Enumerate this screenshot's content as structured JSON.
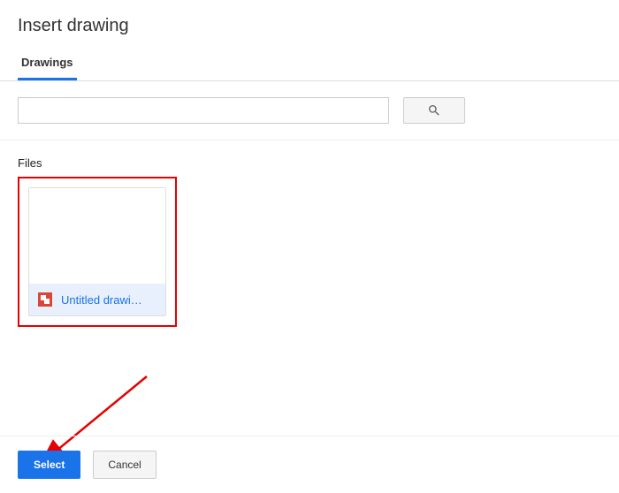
{
  "dialog": {
    "title": "Insert drawing"
  },
  "tabs": {
    "active": "Drawings"
  },
  "search": {
    "value": "",
    "placeholder": ""
  },
  "section": {
    "label": "Files"
  },
  "files": [
    {
      "name": "Untitled drawi…",
      "icon": "drawings-icon"
    }
  ],
  "footer": {
    "select_label": "Select",
    "cancel_label": "Cancel"
  }
}
